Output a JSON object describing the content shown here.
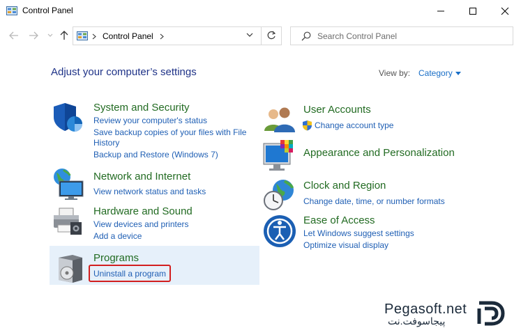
{
  "window": {
    "title": "Control Panel",
    "buttons": [
      "minimize",
      "maximize",
      "close"
    ]
  },
  "nav": {
    "breadcrumb": [
      "Control Panel"
    ],
    "search_placeholder": "Search Control Panel"
  },
  "main": {
    "heading": "Adjust your computer’s settings",
    "view_by_label": "View by:",
    "view_by_value": "Category"
  },
  "categories": {
    "system_security": {
      "title": "System and Security",
      "links": [
        "Review your computer's status",
        "Save backup copies of your files with File",
        "History",
        "Backup and Restore (Windows 7)"
      ]
    },
    "network": {
      "title": "Network and Internet",
      "links": [
        "View network status and tasks"
      ]
    },
    "hardware": {
      "title": "Hardware and Sound",
      "links": [
        "View devices and printers",
        "Add a device"
      ]
    },
    "programs": {
      "title": "Programs",
      "links": [
        "Uninstall a program"
      ]
    },
    "user_accounts": {
      "title": "User Accounts",
      "links": [
        "Change account type"
      ]
    },
    "appearance": {
      "title": "Appearance and Personalization"
    },
    "clock": {
      "title": "Clock and Region",
      "links": [
        "Change date, time, or number formats"
      ]
    },
    "ease": {
      "title": "Ease of Access",
      "links": [
        "Let Windows suggest settings",
        "Optimize visual display"
      ]
    }
  },
  "watermark": {
    "latin": "Pegasoft.net",
    "persian": "پیجاسوفت.نت"
  },
  "colors": {
    "category_title": "#226b22",
    "link": "#1f5fb4",
    "heading": "#1e3287",
    "highlight": "#e6f0fa",
    "annotation": "#d21f1f"
  }
}
